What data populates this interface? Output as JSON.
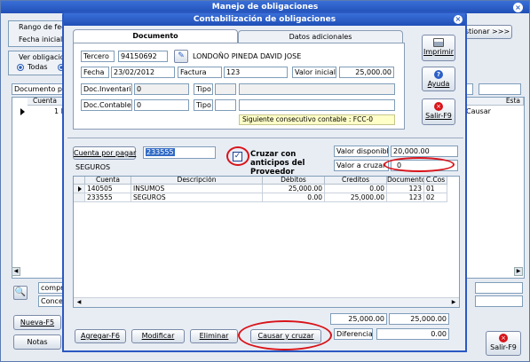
{
  "main": {
    "title": "Manejo de obligaciones",
    "rango": "Rango de fec",
    "fecha_inicial": "Fecha inicial",
    "ver_obligaciones": "Ver obligacio",
    "todas": "Todas",
    "documento_pro": "Documento pro",
    "cuenta": "Cuenta",
    "row_value": "1 F",
    "gestionar": "stionar >>>",
    "esta": "Esta",
    "causar": "Causar",
    "compra": "compra",
    "concep": "Concep",
    "nueva": "Nueva-F5",
    "notas": "Notas",
    "salir": "Salir-F9"
  },
  "dialog": {
    "title": "Contabilización de obligaciones",
    "tabs": [
      "Documento",
      "Datos adicionales"
    ],
    "tercero_label": "Tercero",
    "tercero_value": "94150692",
    "tercero_name": "LONDOÑO PINEDA DAVID JOSE",
    "fecha_label": "Fecha",
    "fecha_value": "23/02/2012",
    "factura_label": "Factura",
    "factura_value": "123",
    "valor_inicial_label": "Valor inicial",
    "valor_inicial_value": "25,000.00",
    "doc_inv_label": "Doc.Inventario",
    "doc_inv_value": "0",
    "tipo_label": "Tipo",
    "doc_cont_label": "Doc.Contable",
    "doc_cont_value": "0",
    "siguiente": "Siguiente consecutivo contable : FCC-0",
    "imprimir": "Imprimir",
    "ayuda": "Ayuda",
    "salir": "Salir-F9",
    "cuenta_por_pagar_btn": "Cuenta por pagar",
    "cuenta_value": "233555",
    "cuenta_desc": "SEGUROS",
    "cruzar_label": "Cruzar con anticipos del Proveedor",
    "valor_disponible_label": "Valor disponible",
    "valor_disponible_value": "20,000.00",
    "valor_cruzar_label": "Valor a cruzar",
    "valor_cruzar_value": "0",
    "grid": {
      "headers": [
        "Cuenta",
        "Descripción",
        "Débitos",
        "Creditos",
        "Documento",
        "C.Cos"
      ],
      "rows": [
        [
          "140505",
          "INSUMOS",
          "25,000.00",
          "0.00",
          "123",
          "01"
        ],
        [
          "233555",
          "SEGUROS",
          "0.00",
          "25,000.00",
          "123",
          "02"
        ]
      ]
    },
    "total_debitos": "25,000.00",
    "total_creditos": "25,000.00",
    "diferencia_label": "Diferencia",
    "diferencia_value": "0.00",
    "agregar": "Agregar-F6",
    "modificar": "Modificar",
    "eliminar": "Eliminar",
    "causar_cruzar": "Causar y cruzar"
  },
  "colors": {
    "title_bar": "#2c5fc8",
    "highlight": "#d8141a",
    "selection": "#316ac5",
    "note_bg": "#ffffc8"
  }
}
